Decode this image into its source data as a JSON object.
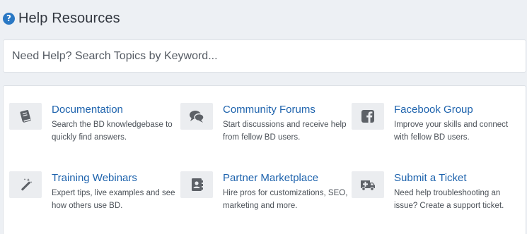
{
  "header": {
    "title": "Help Resources",
    "icon": "question-circle-icon"
  },
  "search": {
    "placeholder": "Need Help? Search Topics by Keyword..."
  },
  "resources": [
    {
      "title": "Documentation",
      "description": "Search the BD knowledgebase to quickly find answers.",
      "icon": "book-icon"
    },
    {
      "title": "Community Forums",
      "description": "Start discussions and receive help from fellow BD users.",
      "icon": "comments-icon"
    },
    {
      "title": "Facebook Group",
      "description": "Improve your skills and connect with fellow BD users.",
      "icon": "facebook-icon"
    },
    {
      "title": "Training Webinars",
      "description": "Expert tips, live examples and see how others use BD.",
      "icon": "magic-wand-icon"
    },
    {
      "title": "Partner Marketplace",
      "description": "Hire pros for customizations, SEO, marketing and more.",
      "icon": "contact-book-icon"
    },
    {
      "title": "Submit a Ticket",
      "description": "Need help troubleshooting an issue? Create a support ticket.",
      "icon": "ambulance-icon"
    }
  ],
  "colors": {
    "link": "#1e63ad",
    "accent": "#2a78c4",
    "icon": "#5d6167",
    "icon_bg": "#ebedf0"
  }
}
